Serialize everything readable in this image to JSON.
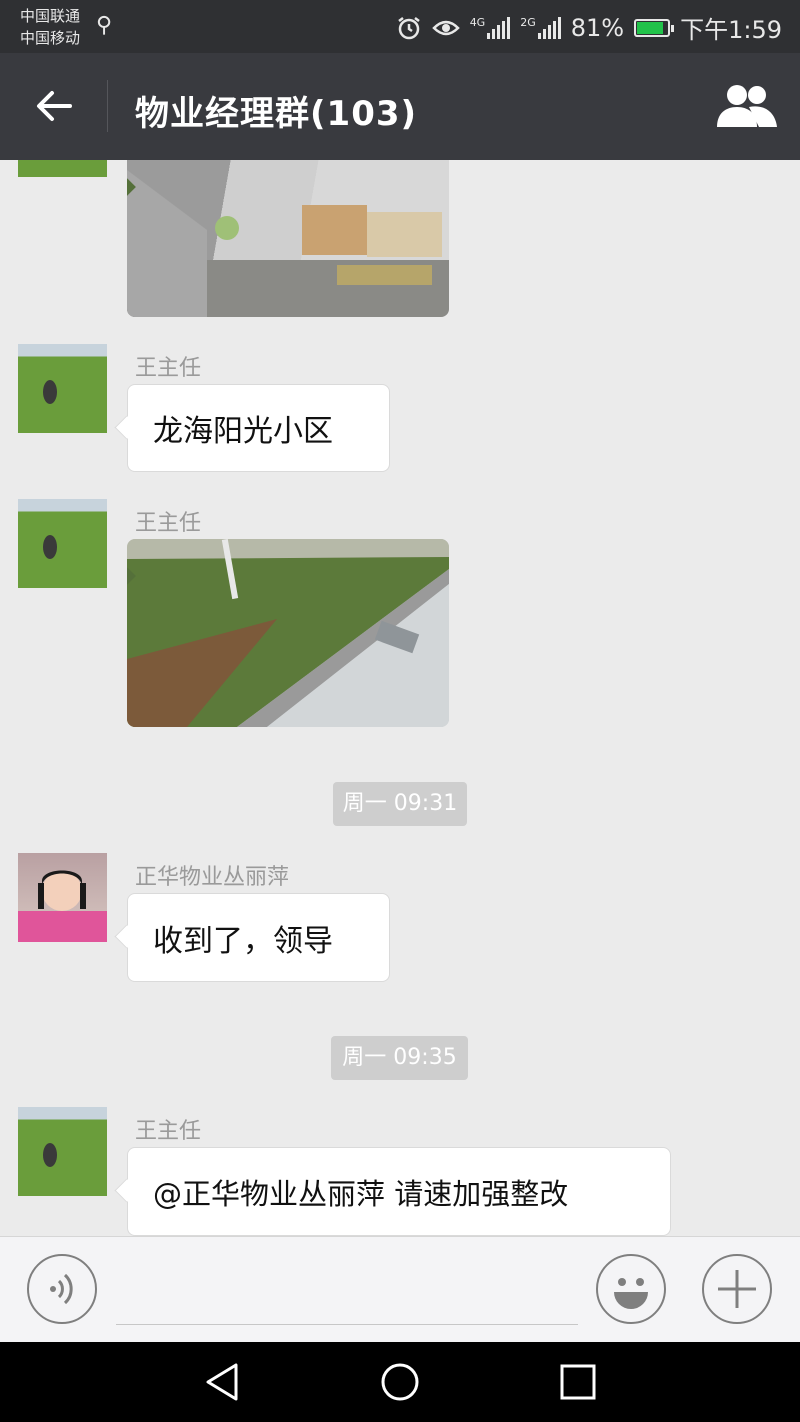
{
  "status_bar": {
    "carrier_1": "中国联通",
    "carrier_2": "中国移动",
    "net_4g": "4G",
    "net_2g": "2G",
    "battery": "81%",
    "time": "下午1:59"
  },
  "header": {
    "title": "物业经理群(103)"
  },
  "messages": [
    {
      "sender": "王主任",
      "text": "龙海阳光小区"
    },
    {
      "sender": "王主任"
    },
    {
      "timestamp": "周一 09:31"
    },
    {
      "sender": "正华物业丛丽萍",
      "text": "收到了，领导"
    },
    {
      "timestamp": "周一 09:35"
    },
    {
      "sender": "王主任",
      "text": "@正华物业丛丽萍 请速加强整改"
    }
  ],
  "colors": {
    "navbar": "#393a3f",
    "statusbar": "#2f3033",
    "chat_bg": "#ebebeb",
    "battery": "#22c24a"
  }
}
